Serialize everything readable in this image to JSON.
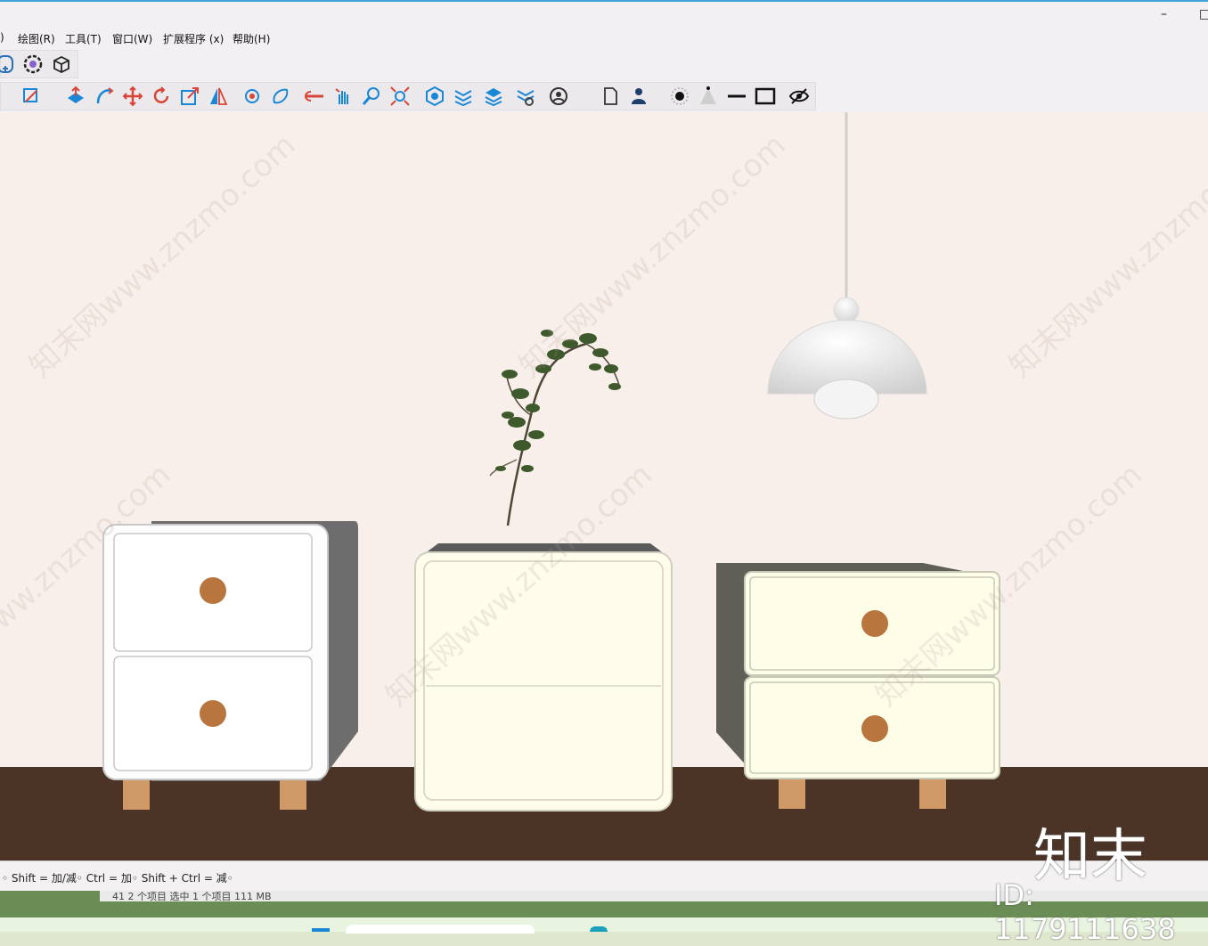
{
  "window": {
    "minimize": "–",
    "maximize": "□"
  },
  "menu": {
    "partial": ")",
    "items": [
      "绘图(R)",
      "工具(T)",
      "窗口(W)",
      "扩展程序 (x)",
      "帮助(H)"
    ]
  },
  "status": {
    "hint": "◦ Shift = 加/减◦ Ctrl = 加◦ Shift + Ctrl = 减◦",
    "explorer_info": "41   2 个项目    选中 1 个项目  111 MB"
  },
  "watermark": {
    "text": "知末网www.znzmo.com",
    "brand": "知末",
    "id": "ID: 1179111638"
  },
  "icons_row1": [
    "add-icon",
    "gear-icon",
    "component-icon"
  ],
  "icons_row2": [
    "pencil-icon",
    "push-pull-icon",
    "follow-me-icon",
    "move-icon",
    "rotate-icon",
    "scale-icon",
    "flip-icon",
    "orbit-icon",
    "pan-icon",
    "section-icon",
    "hand-icon",
    "zoom-icon",
    "zoom-extents-icon",
    "style-icon",
    "layers-icon",
    "stack-icon",
    "settings-icon",
    "user-icon",
    "page-icon",
    "person-icon",
    "dot-icon",
    "cone-icon",
    "line-icon",
    "rectangle-icon",
    "hide-icon"
  ],
  "colors": {
    "wall": "#f9efea",
    "floor": "#4b3426",
    "accent": "#1a86d6",
    "toolbar": "#f3f0f3"
  }
}
